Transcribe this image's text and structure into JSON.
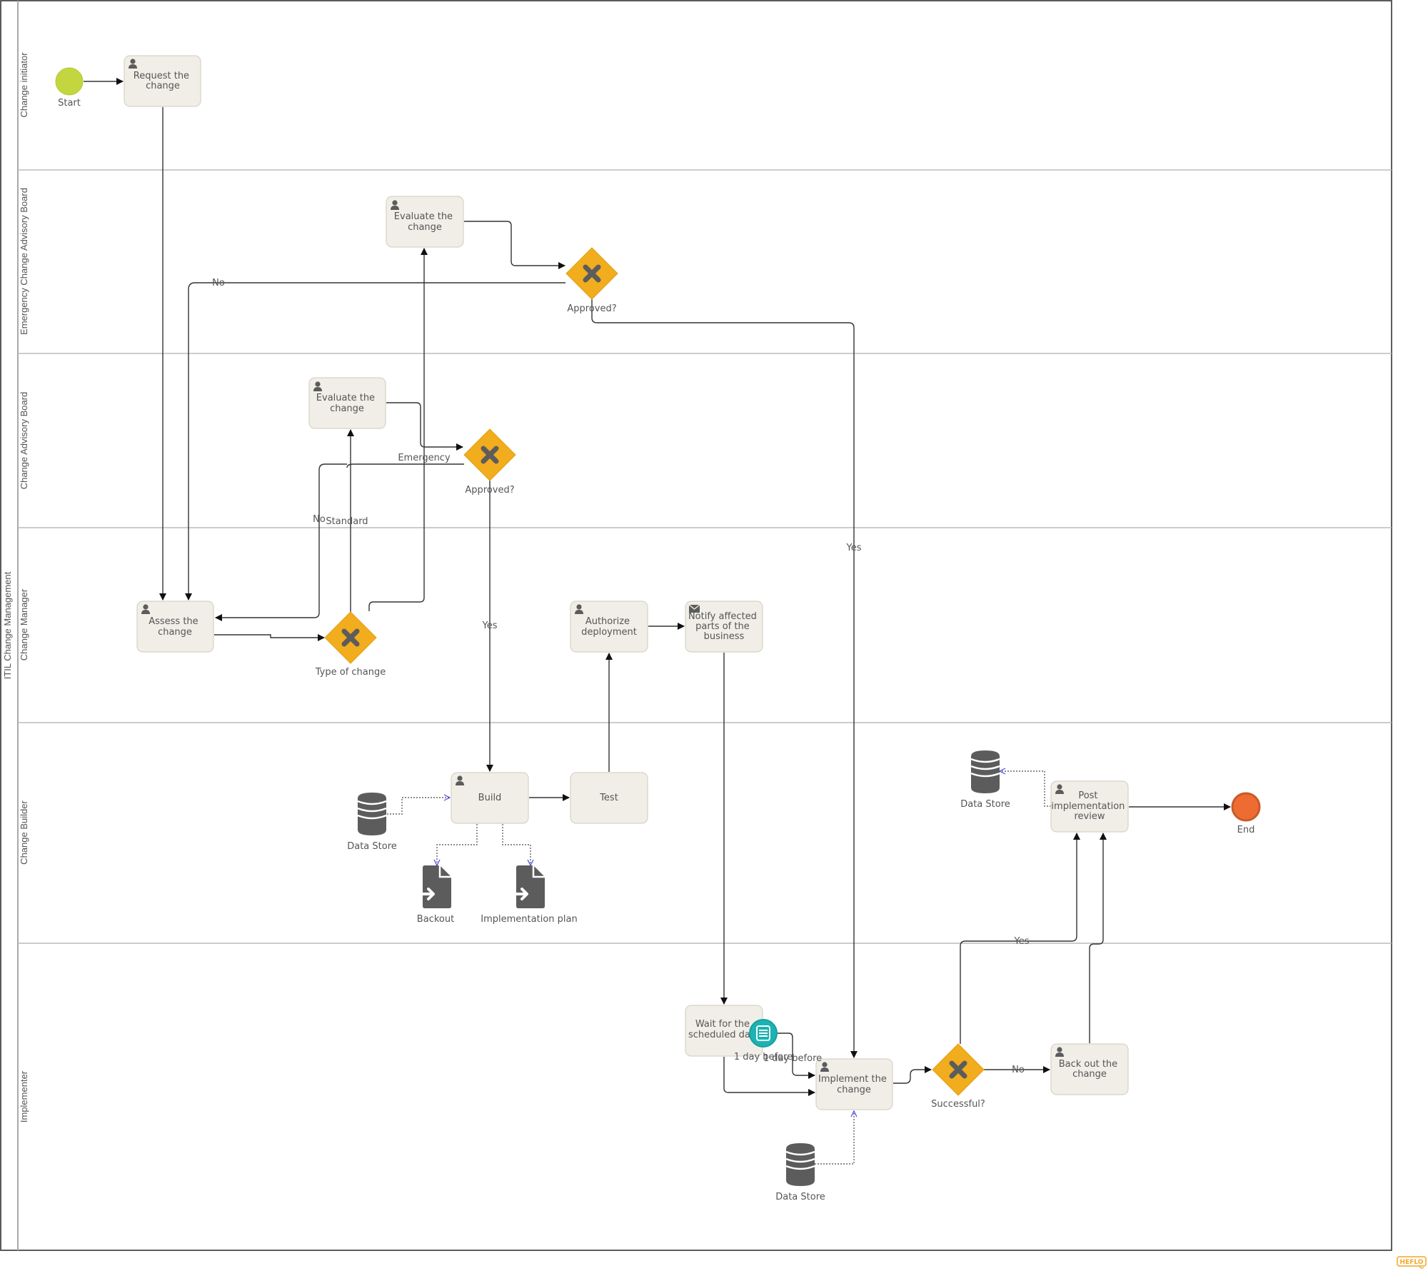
{
  "pool": {
    "name": "ITIL Change Management"
  },
  "lanes": [
    {
      "id": "initiator",
      "name": "Change initiator"
    },
    {
      "id": "ecab",
      "name": "Emergency Change Advisory Board"
    },
    {
      "id": "cab",
      "name": "Change Advisory Board"
    },
    {
      "id": "manager",
      "name": "Change Manager"
    },
    {
      "id": "builder",
      "name": "Change Builder"
    },
    {
      "id": "implementer",
      "name": "Implementer"
    }
  ],
  "events": {
    "start": {
      "label": "Start",
      "color": "#c3d63f"
    },
    "end": {
      "label": "End",
      "color": "#ee6c32"
    },
    "timer": {
      "label_1": "1 day before",
      "label_2": "1 day before",
      "color": "#1bb3b3"
    }
  },
  "tasks": {
    "request": {
      "lines": [
        "Request the",
        "change"
      ],
      "type": "user"
    },
    "ecab_evaluate": {
      "lines": [
        "Evaluate the",
        "change"
      ],
      "type": "user"
    },
    "cab_evaluate": {
      "lines": [
        "Evaluate the",
        "change"
      ],
      "type": "user"
    },
    "assess": {
      "lines": [
        "Assess the",
        "change"
      ],
      "type": "user"
    },
    "authorize": {
      "lines": [
        "Authorize",
        "deployment"
      ],
      "type": "user"
    },
    "notify": {
      "lines": [
        "Notify affected",
        "parts of the",
        "business"
      ],
      "type": "send"
    },
    "build": {
      "lines": [
        "Build"
      ],
      "type": "user"
    },
    "test": {
      "lines": [
        "Test"
      ],
      "type": "none"
    },
    "post_review": {
      "lines": [
        "Post",
        "implementation",
        "review"
      ],
      "type": "user"
    },
    "wait": {
      "lines": [
        "Wait for the",
        "scheduled date"
      ],
      "type": "none"
    },
    "implement": {
      "lines": [
        "Implement the",
        "change"
      ],
      "type": "user"
    },
    "backout": {
      "lines": [
        "Back out the",
        "change"
      ],
      "type": "user"
    }
  },
  "gateways": {
    "ecab_approved": {
      "label": "Approved?"
    },
    "cab_approved": {
      "label": "Approved?"
    },
    "type_of_change": {
      "label": "Type of change"
    },
    "successful": {
      "label": "Successful?"
    }
  },
  "data_objects": {
    "backout_doc": {
      "label": "Backout"
    },
    "impl_plan_doc": {
      "label": "Implementation plan"
    }
  },
  "data_stores": {
    "build_ds": {
      "label": "Data Store"
    },
    "review_ds": {
      "label": "Data Store"
    },
    "implement_ds": {
      "label": "Data Store"
    }
  },
  "flow_labels": {
    "ecab_no": "No",
    "ecab_yes": "Yes",
    "cab_emergency": "Emergency",
    "cab_no": "No",
    "standard": "Standard",
    "cab_yes": "Yes",
    "success_yes": "Yes",
    "success_no": "No"
  },
  "colors": {
    "gateway": "#f1ad1d",
    "task_fill": "#f0eee6",
    "brand": "#f5a623"
  },
  "brand": {
    "logo_text": "HEFLO"
  }
}
